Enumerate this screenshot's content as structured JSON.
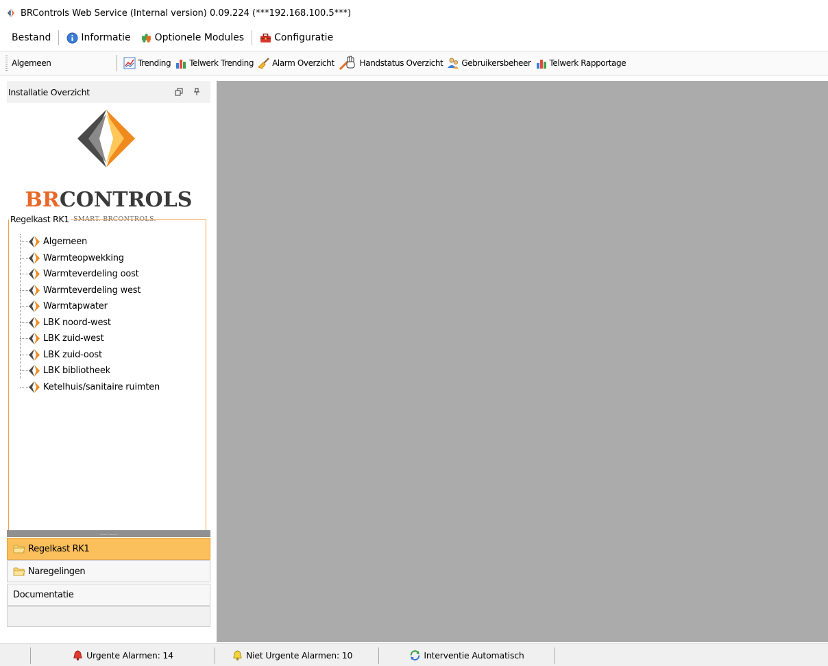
{
  "window": {
    "title": "BRControls Web Service (Internal version)  0.09.224 (***192.168.100.5***)"
  },
  "menubar": {
    "items": [
      {
        "label": "Bestand",
        "icon": null
      },
      {
        "label": "Informatie",
        "icon": "info-icon"
      },
      {
        "label": "Optionele Modules",
        "icon": "puzzle-icon"
      },
      {
        "label": "Configuratie",
        "icon": "toolbox-icon"
      }
    ]
  },
  "toolbar": {
    "general_label": "Algemeen",
    "items": [
      {
        "label": "Trending",
        "icon": "trend-chart-icon"
      },
      {
        "label": "Telwerk Trending",
        "icon": "bar-chart-icon"
      },
      {
        "label": "Alarm Overzicht",
        "icon": "broom-icon"
      },
      {
        "label": "Handstatus Overzicht",
        "icon": "hand-icon"
      },
      {
        "label": "Gebruikersbeheer",
        "icon": "users-icon"
      },
      {
        "label": "Telwerk Rapportage",
        "icon": "bar-chart-icon"
      }
    ]
  },
  "left_panel": {
    "header": "Installatie Overzicht",
    "logo": {
      "brand_accent": "BR",
      "brand_rest": "CONTROLS",
      "tagline": "BE SMART. BRCONTROLS."
    },
    "group_title": "Regelkast RK1",
    "tree": [
      "Algemeen",
      "Warmteopwekking",
      "Warmteverdeling oost",
      "Warmteverdeling west",
      "Warmtapwater",
      "LBK noord-west",
      "LBK zuid-west",
      "LBK zuid-oost",
      "LBK bibliotheek",
      "Ketelhuis/sanitaire ruimten"
    ],
    "nav": [
      {
        "label": "Regelkast RK1",
        "active": true,
        "icon": "folder-icon"
      },
      {
        "label": "Naregelingen",
        "active": false,
        "icon": "folder-icon"
      },
      {
        "label": "Documentatie",
        "active": false,
        "icon": null
      }
    ]
  },
  "statusbar": {
    "urgent": "Urgente Alarmen: 14",
    "non_urgent": "Niet Urgente Alarmen: 10",
    "intervention": "Interventie Automatisch"
  },
  "colors": {
    "accent_orange": "#e8682a",
    "nav_active": "#fbbf5c",
    "main_bg": "#ababab",
    "group_border": "#f0a040"
  }
}
